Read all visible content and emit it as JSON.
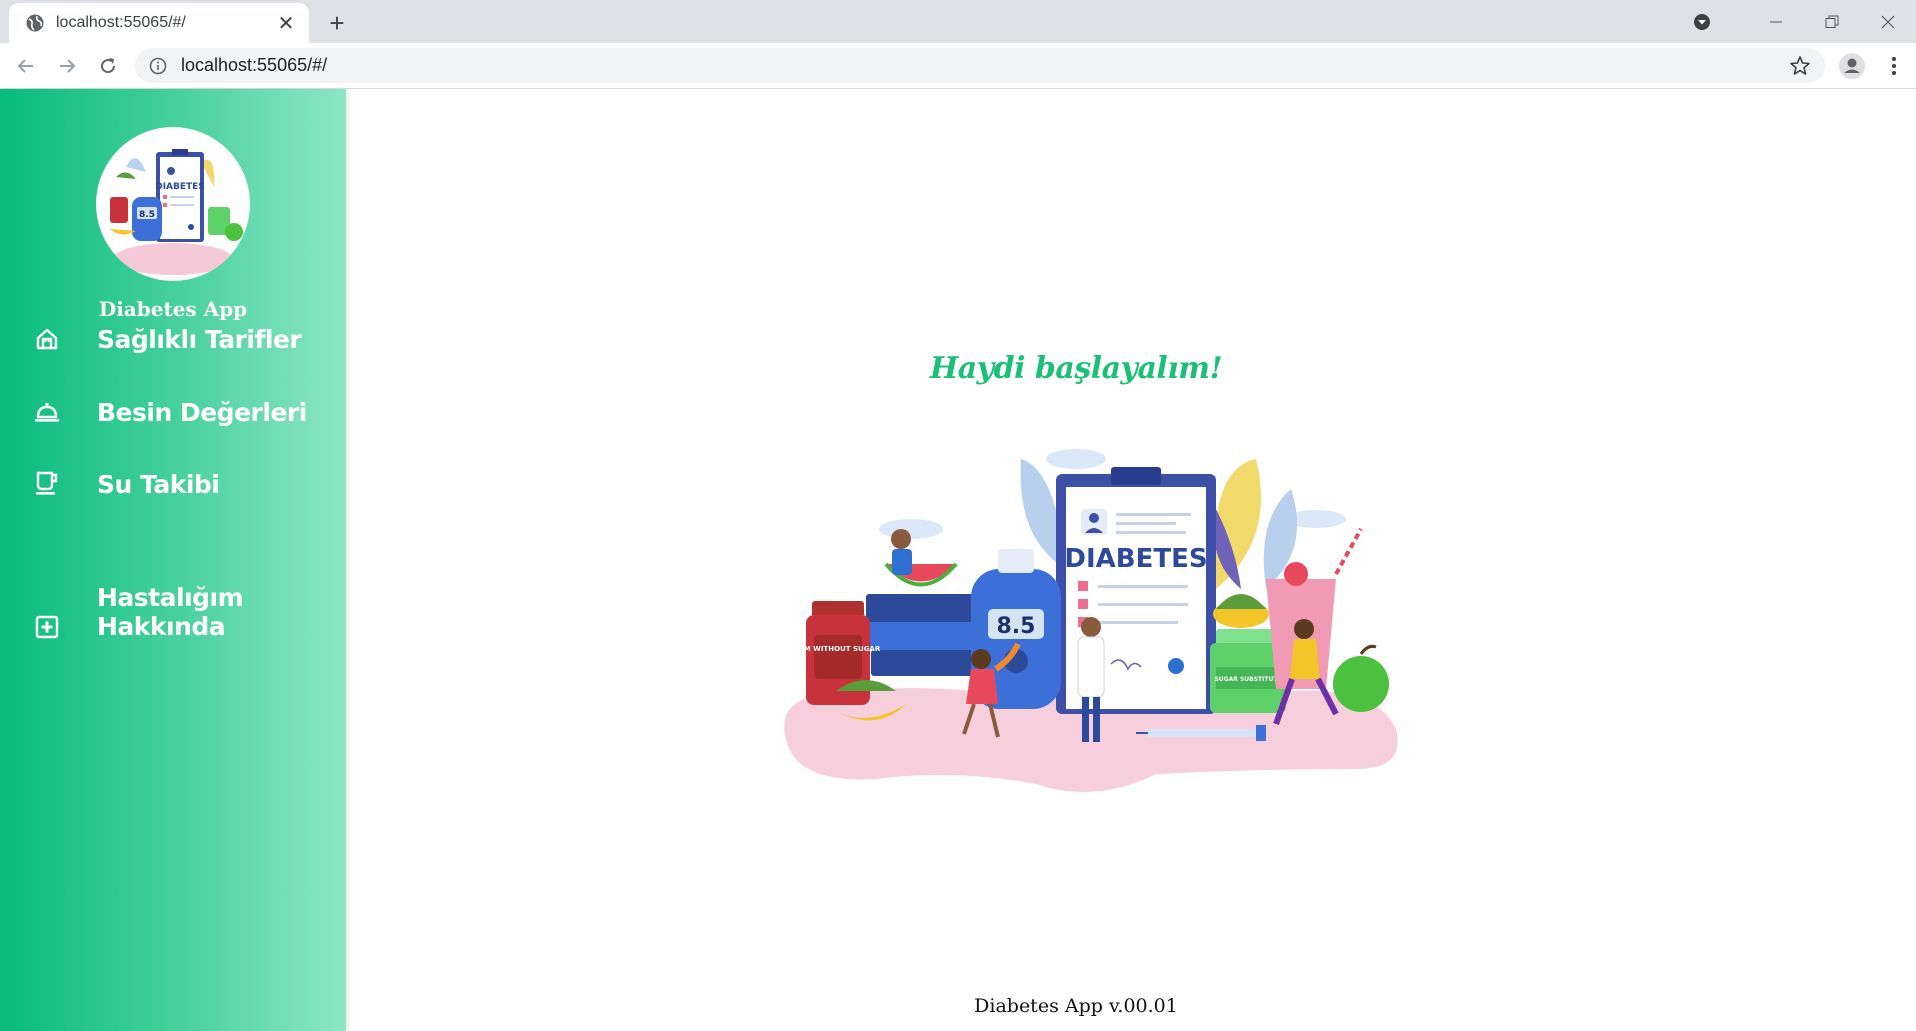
{
  "browser": {
    "tab_title": "localhost:55065/#/",
    "url": "localhost:55065/#/",
    "new_tab_symbol": "+",
    "close_symbol": "✕"
  },
  "sidebar": {
    "app_name": "Diabetes App",
    "items": [
      {
        "label": "Sağlıklı Tarifler",
        "icon": "home-icon"
      },
      {
        "label": "Besin Değerleri",
        "icon": "dish-icon"
      },
      {
        "label": "Su Takibi",
        "icon": "cup-icon"
      },
      {
        "label": "Hastalığım",
        "label2": "Hakkında",
        "icon": "medical-plus-icon"
      }
    ],
    "logo_text": "DIABETES",
    "logo_reading": "8.5"
  },
  "main": {
    "headline": "Haydi başlayalım!",
    "illustration": {
      "clipboard_title": "DIABETES",
      "meter_reading": "8.5",
      "jar_label": "JAM WITHOUT SUGAR",
      "bottle_label": "SUGAR SUBSTITUTE"
    },
    "footer": "Diabetes App v.00.01"
  },
  "colors": {
    "sidebar_start": "#08bb7d",
    "sidebar_end": "#8ee6c7",
    "headline": "#1bbf78"
  }
}
